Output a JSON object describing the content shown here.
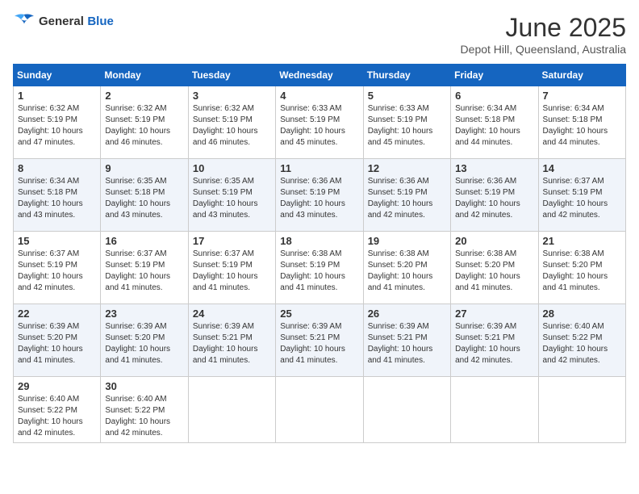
{
  "logo": {
    "general": "General",
    "blue": "Blue"
  },
  "title": "June 2025",
  "subtitle": "Depot Hill, Queensland, Australia",
  "weekdays": [
    "Sunday",
    "Monday",
    "Tuesday",
    "Wednesday",
    "Thursday",
    "Friday",
    "Saturday"
  ],
  "weeks": [
    [
      {
        "day": 1,
        "sunrise": "6:32 AM",
        "sunset": "5:19 PM",
        "daylight": "10 hours and 47 minutes."
      },
      {
        "day": 2,
        "sunrise": "6:32 AM",
        "sunset": "5:19 PM",
        "daylight": "10 hours and 46 minutes."
      },
      {
        "day": 3,
        "sunrise": "6:32 AM",
        "sunset": "5:19 PM",
        "daylight": "10 hours and 46 minutes."
      },
      {
        "day": 4,
        "sunrise": "6:33 AM",
        "sunset": "5:19 PM",
        "daylight": "10 hours and 45 minutes."
      },
      {
        "day": 5,
        "sunrise": "6:33 AM",
        "sunset": "5:19 PM",
        "daylight": "10 hours and 45 minutes."
      },
      {
        "day": 6,
        "sunrise": "6:34 AM",
        "sunset": "5:18 PM",
        "daylight": "10 hours and 44 minutes."
      },
      {
        "day": 7,
        "sunrise": "6:34 AM",
        "sunset": "5:18 PM",
        "daylight": "10 hours and 44 minutes."
      }
    ],
    [
      {
        "day": 8,
        "sunrise": "6:34 AM",
        "sunset": "5:18 PM",
        "daylight": "10 hours and 43 minutes."
      },
      {
        "day": 9,
        "sunrise": "6:35 AM",
        "sunset": "5:18 PM",
        "daylight": "10 hours and 43 minutes."
      },
      {
        "day": 10,
        "sunrise": "6:35 AM",
        "sunset": "5:19 PM",
        "daylight": "10 hours and 43 minutes."
      },
      {
        "day": 11,
        "sunrise": "6:36 AM",
        "sunset": "5:19 PM",
        "daylight": "10 hours and 43 minutes."
      },
      {
        "day": 12,
        "sunrise": "6:36 AM",
        "sunset": "5:19 PM",
        "daylight": "10 hours and 42 minutes."
      },
      {
        "day": 13,
        "sunrise": "6:36 AM",
        "sunset": "5:19 PM",
        "daylight": "10 hours and 42 minutes."
      },
      {
        "day": 14,
        "sunrise": "6:37 AM",
        "sunset": "5:19 PM",
        "daylight": "10 hours and 42 minutes."
      }
    ],
    [
      {
        "day": 15,
        "sunrise": "6:37 AM",
        "sunset": "5:19 PM",
        "daylight": "10 hours and 42 minutes."
      },
      {
        "day": 16,
        "sunrise": "6:37 AM",
        "sunset": "5:19 PM",
        "daylight": "10 hours and 41 minutes."
      },
      {
        "day": 17,
        "sunrise": "6:37 AM",
        "sunset": "5:19 PM",
        "daylight": "10 hours and 41 minutes."
      },
      {
        "day": 18,
        "sunrise": "6:38 AM",
        "sunset": "5:19 PM",
        "daylight": "10 hours and 41 minutes."
      },
      {
        "day": 19,
        "sunrise": "6:38 AM",
        "sunset": "5:20 PM",
        "daylight": "10 hours and 41 minutes."
      },
      {
        "day": 20,
        "sunrise": "6:38 AM",
        "sunset": "5:20 PM",
        "daylight": "10 hours and 41 minutes."
      },
      {
        "day": 21,
        "sunrise": "6:38 AM",
        "sunset": "5:20 PM",
        "daylight": "10 hours and 41 minutes."
      }
    ],
    [
      {
        "day": 22,
        "sunrise": "6:39 AM",
        "sunset": "5:20 PM",
        "daylight": "10 hours and 41 minutes."
      },
      {
        "day": 23,
        "sunrise": "6:39 AM",
        "sunset": "5:20 PM",
        "daylight": "10 hours and 41 minutes."
      },
      {
        "day": 24,
        "sunrise": "6:39 AM",
        "sunset": "5:21 PM",
        "daylight": "10 hours and 41 minutes."
      },
      {
        "day": 25,
        "sunrise": "6:39 AM",
        "sunset": "5:21 PM",
        "daylight": "10 hours and 41 minutes."
      },
      {
        "day": 26,
        "sunrise": "6:39 AM",
        "sunset": "5:21 PM",
        "daylight": "10 hours and 41 minutes."
      },
      {
        "day": 27,
        "sunrise": "6:39 AM",
        "sunset": "5:21 PM",
        "daylight": "10 hours and 42 minutes."
      },
      {
        "day": 28,
        "sunrise": "6:40 AM",
        "sunset": "5:22 PM",
        "daylight": "10 hours and 42 minutes."
      }
    ],
    [
      {
        "day": 29,
        "sunrise": "6:40 AM",
        "sunset": "5:22 PM",
        "daylight": "10 hours and 42 minutes."
      },
      {
        "day": 30,
        "sunrise": "6:40 AM",
        "sunset": "5:22 PM",
        "daylight": "10 hours and 42 minutes."
      },
      null,
      null,
      null,
      null,
      null
    ]
  ]
}
